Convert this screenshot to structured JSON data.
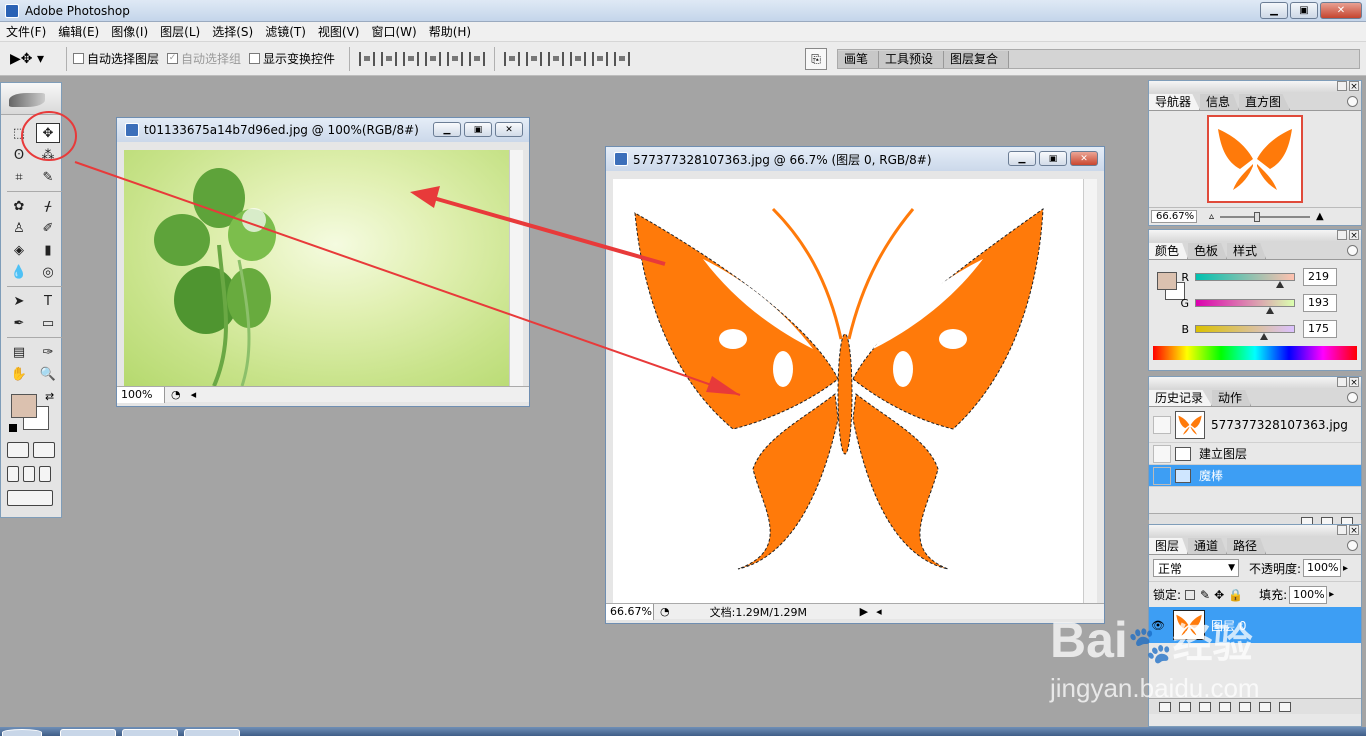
{
  "app": {
    "title": "Adobe Photoshop"
  },
  "window_controls": {
    "minimize": "▁",
    "maximize": "▣",
    "close": "✕"
  },
  "menu": [
    "文件(F)",
    "编辑(E)",
    "图像(I)",
    "图层(L)",
    "选择(S)",
    "滤镜(T)",
    "视图(V)",
    "窗口(W)",
    "帮助(H)"
  ],
  "options_bar": {
    "tool_glyph": "▶✥ ▾",
    "auto_select_layer": "自动选择图层",
    "auto_select_group": "自动选择组",
    "show_transform": "显示变换控件",
    "palette_tabs": [
      "画笔",
      "工具预设",
      "图层复合"
    ]
  },
  "toolbox": {
    "tools": [
      "⬚",
      "✥",
      "ʘ",
      "⁂",
      "⌗",
      "✎",
      "✿",
      "ᚋ",
      "♙",
      "✐",
      "◈",
      "▮",
      "💧",
      "◎",
      "➤",
      "T",
      "✒",
      "▭",
      "▤",
      "✑",
      "✋",
      "🔍"
    ],
    "foreground_color": "#dbc1af",
    "background_color": "#ffffff"
  },
  "doc1": {
    "title": "t01133675a14b7d96ed.jpg @ 100%(RGB/8#)",
    "zoom": "100%"
  },
  "doc2": {
    "title": "577377328107363.jpg @ 66.7% (图层 0, RGB/8#)",
    "zoom": "66.67%",
    "doc_info": "文档:1.29M/1.29M"
  },
  "navigator": {
    "tabs": [
      "导航器",
      "信息",
      "直方图"
    ],
    "zoom": "66.67%"
  },
  "color_panel": {
    "tabs": [
      "颜色",
      "色板",
      "样式"
    ],
    "r_label": "R",
    "g_label": "G",
    "b_label": "B",
    "r": "219",
    "g": "193",
    "b": "175",
    "r_level": 0.86,
    "g_level": 0.76,
    "b_level": 0.69
  },
  "history_panel": {
    "tabs": [
      "历史记录",
      "动作"
    ],
    "snapshot": "577377328107363.jpg",
    "items": [
      "建立图层",
      "魔棒"
    ]
  },
  "layers_panel": {
    "tabs": [
      "图层",
      "通道",
      "路径"
    ],
    "blend_mode": "正常",
    "opacity_label": "不透明度:",
    "opacity": "100%",
    "lock_label": "锁定:",
    "fill_label": "填充:",
    "fill": "100%",
    "layer_name": "图层 0"
  },
  "watermark": {
    "brand": "Bai",
    "brand_tail": "经验",
    "url": "jingyan.baidu.com"
  },
  "colors": {
    "accent_selection": "#3d9ef4",
    "butterfly": "#ff7a0a",
    "annotation_red": "#e83a3a"
  }
}
